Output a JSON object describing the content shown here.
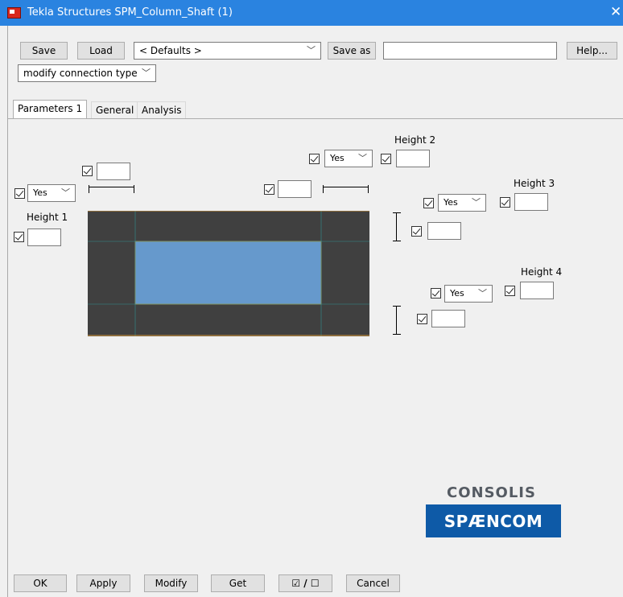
{
  "window": {
    "title": "Tekla Structures  SPM_Column_Shaft (1)",
    "close_glyph": "✕",
    "icon": "tekla-app-icon"
  },
  "toolbar": {
    "save_label": "Save",
    "load_label": "Load",
    "defaults_value": "< Defaults >",
    "save_as_label": "Save as",
    "save_as_value": "",
    "help_label": "Help...",
    "mode_value": "modify connection type"
  },
  "tabs": [
    {
      "label": "Parameters 1",
      "active": true
    },
    {
      "label": "General",
      "active": false
    },
    {
      "label": "Analysis",
      "active": false
    }
  ],
  "params": {
    "height1_label": "Height 1",
    "height2_label": "Height 2",
    "height3_label": "Height 3",
    "height4_label": "Height 4",
    "yes_value": "Yes"
  },
  "colors": {
    "frame_dark": "#404040",
    "opening_fill": "#6699cc",
    "edge_orange": "#d99a3a",
    "title_bar": "#2a83e0",
    "logo_blue": "#0e5aa7"
  },
  "logo": {
    "top_text": "CONSOLIS",
    "bottom_text": "SPÆNCOM"
  },
  "footer": {
    "ok_label": "OK",
    "apply_label": "Apply",
    "modify_label": "Modify",
    "get_label": "Get",
    "toggle_label": "☑ / ☐",
    "cancel_label": "Cancel"
  }
}
